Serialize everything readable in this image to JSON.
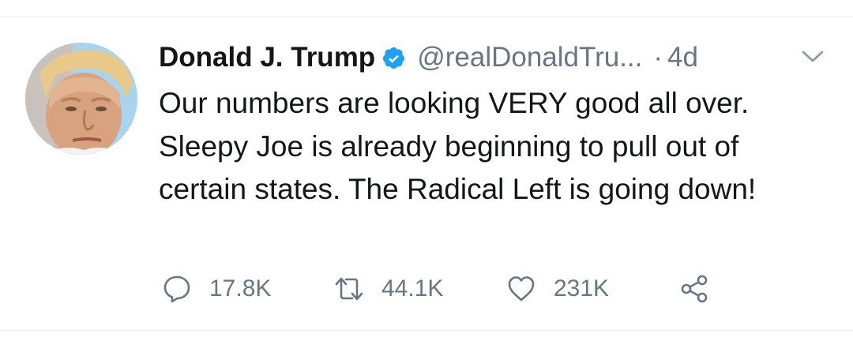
{
  "tweet": {
    "display_name": "Donald J. Trump",
    "handle": "@realDonaldTru...",
    "separator": "·",
    "timestamp": "4d",
    "verified": true,
    "text": "Our numbers are looking VERY good all over. Sleepy Joe is already beginning to pull out of certain states. The Radical Left is going down!",
    "avatar_icon": "profile-photo"
  },
  "actions": {
    "reply": {
      "icon": "reply-icon",
      "count": "17.8K"
    },
    "retweet": {
      "icon": "retweet-icon",
      "count": "44.1K"
    },
    "like": {
      "icon": "heart-icon",
      "count": "231K"
    },
    "share": {
      "icon": "share-icon"
    }
  },
  "colors": {
    "text": "#14171a",
    "secondary": "#657786",
    "verified_blue": "#1da1f2",
    "divider": "#e6ecf0"
  }
}
